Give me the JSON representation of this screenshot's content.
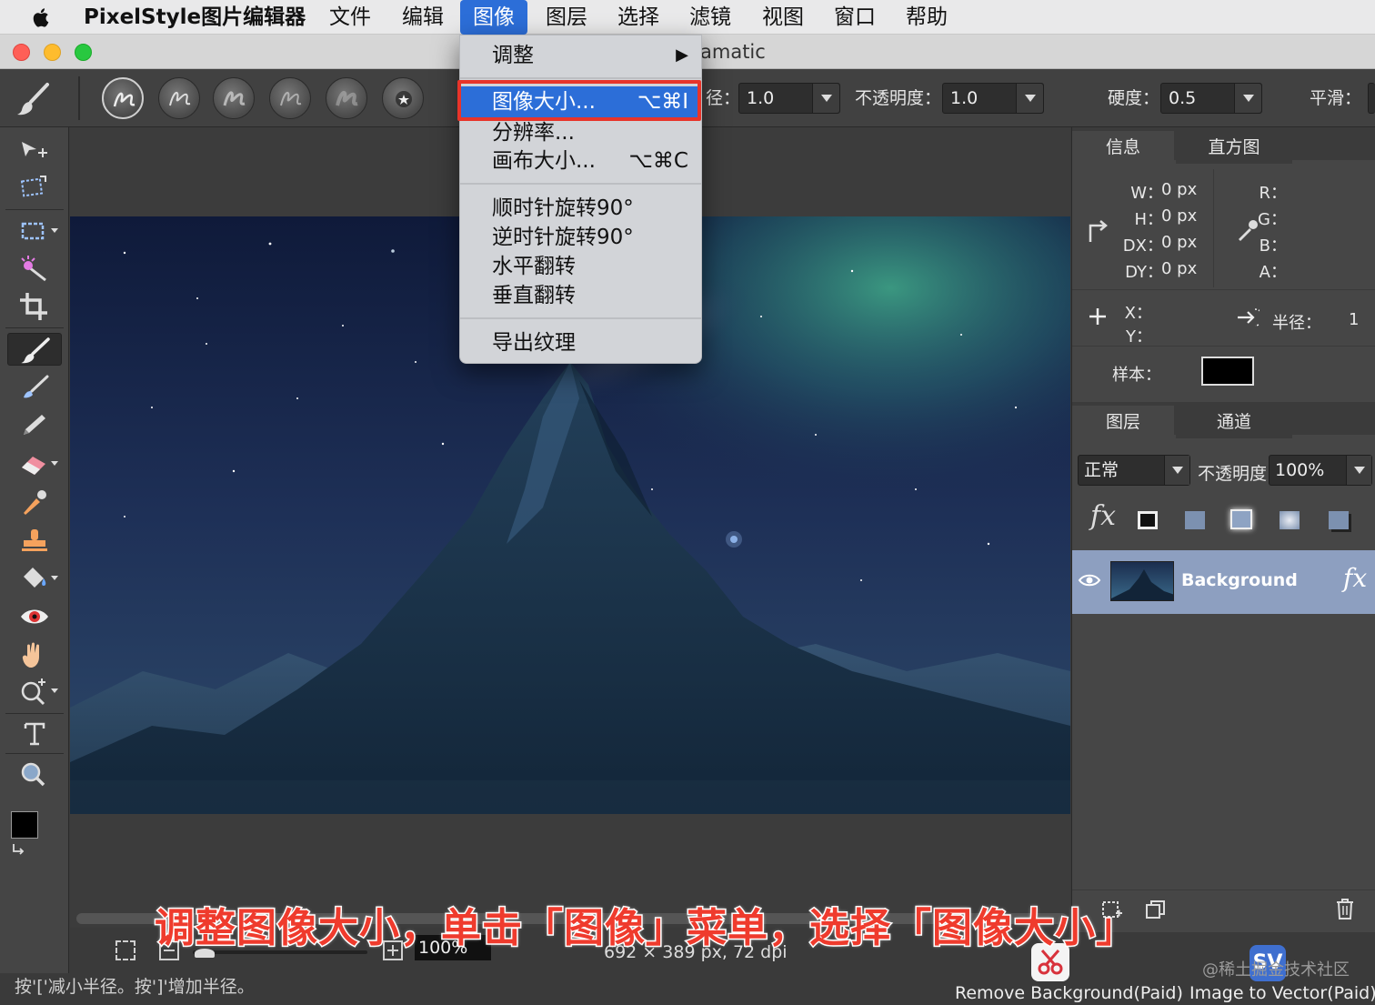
{
  "menubar": {
    "app_name": "PixelStyle图片编辑器",
    "items": [
      "文件",
      "编辑",
      "图像",
      "图层",
      "选择",
      "滤镜",
      "视图",
      "窗口",
      "帮助"
    ],
    "active": "图像"
  },
  "window": {
    "title_fragment": "amatic"
  },
  "options_bar": {
    "radius_label": "径：",
    "radius_value": "1.0",
    "opacity_label": "不透明度：",
    "opacity_value": "1.0",
    "hardness_label": "硬度：",
    "hardness_value": "0.5",
    "smooth_label": "平滑："
  },
  "image_menu": {
    "items": [
      {
        "label": "调整",
        "shortcut": "▶"
      },
      {
        "label": "图像大小...",
        "shortcut": "⌥⌘I",
        "highlighted": true
      },
      {
        "label": "分辨率...",
        "shortcut": ""
      },
      {
        "label": "画布大小...",
        "shortcut": "⌥⌘C"
      },
      {
        "label": "顺时针旋转90°",
        "shortcut": ""
      },
      {
        "label": "逆时针旋转90°",
        "shortcut": ""
      },
      {
        "label": "水平翻转",
        "shortcut": ""
      },
      {
        "label": "垂直翻转",
        "shortcut": ""
      },
      {
        "label": "导出纹理",
        "shortcut": ""
      }
    ]
  },
  "info_panel": {
    "tabs": [
      "信息",
      "直方图"
    ],
    "w_label": "W：",
    "w_value": "0 px",
    "h_label": "H：",
    "h_value": "0 px",
    "dx_label": "DX：",
    "dx_value": "0 px",
    "dy_label": "DY：",
    "dy_value": "0 px",
    "r_label": "R：",
    "g_label": "G：",
    "b_label": "B：",
    "a_label": "A：",
    "x_label": "X：",
    "y_label": "Y：",
    "radius_label": "半径：",
    "radius_value": "1",
    "sample_label": "样本：",
    "sample_color": "#000000"
  },
  "layers_panel": {
    "tabs": [
      "图层",
      "通道"
    ],
    "blend_mode": "正常",
    "opacity_label": "不透明度",
    "opacity_value": "100%",
    "layers": [
      {
        "name": "Background"
      }
    ]
  },
  "status": {
    "zoom": "100%",
    "dimensions": "692 × 389 px, 72 dpi",
    "hint": "按'['减小半径。按']'增加半径。"
  },
  "promos": {
    "remove_bg": "Remove Background(Paid)",
    "to_vector": "Image to Vector(Paid)"
  },
  "caption": "调整图像大小，单击「图像」菜单，选择「图像大小」",
  "watermark": "@稀土掘金技术社区",
  "colors": {
    "menu_highlight": "#2c6ed8",
    "annotation_red": "#e8342a",
    "foreground": "#000000",
    "background": "#ffffff"
  }
}
